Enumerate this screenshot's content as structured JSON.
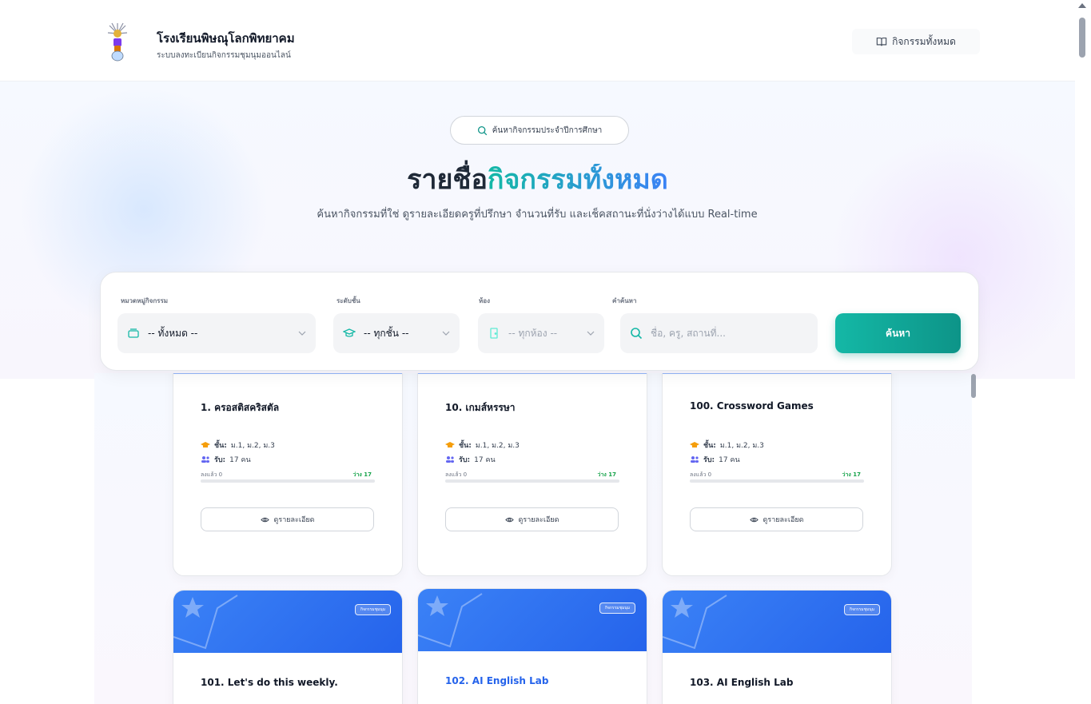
{
  "header": {
    "school_name": "โรงเรียนพิษณุโลกพิทยาคม",
    "subtitle": "ระบบลงทะเบียนกิจกรรมชุมนุมออนไลน์",
    "nav_all_label": "กิจกรรมทั้งหมด"
  },
  "hero": {
    "badge": "ค้นหากิจกรรมประจำปีการศึกษา",
    "title_plain": "รายชื่อ",
    "title_accent": "กิจกรรมทั้งหมด",
    "description": "ค้นหากิจกรรมที่ใช่ ดูรายละเอียดครูที่ปรึกษา จำนวนที่รับ และเช็คสถานะที่นั่งว่างได้แบบ Real-time"
  },
  "filters": {
    "category_label": "หมวดหมู่กิจกรรม",
    "category_value": "-- ทั้งหมด --",
    "grade_label": "ระดับชั้น",
    "grade_value": "-- ทุกชั้น --",
    "room_label": "ห้อง",
    "room_value": "-- ทุกห้อง --",
    "keyword_label": "คำค้นหา",
    "keyword_placeholder": "ชื่อ, ครู, สถานที่...",
    "search_button": "ค้นหา"
  },
  "cards_row1": [
    {
      "title": "1. ครอสติสคริสตัล",
      "grade_label": "ชั้น:",
      "grade_value": "ม.1, ม.2, ม.3",
      "capacity_label": "รับ:",
      "capacity_value": "17 คน",
      "registered": "ลงแล้ว 0",
      "available": "ว่าง 17",
      "detail_button": "ดูรายละเอียด"
    },
    {
      "title": "10. เกมส์หรรษา",
      "grade_label": "ชั้น:",
      "grade_value": "ม.1, ม.2, ม.3",
      "capacity_label": "รับ:",
      "capacity_value": "17 คน",
      "registered": "ลงแล้ว 0",
      "available": "ว่าง 17",
      "detail_button": "ดูรายละเอียด"
    },
    {
      "title": "100. Crossword Games",
      "grade_label": "ชั้น:",
      "grade_value": "ม.1, ม.2, ม.3",
      "capacity_label": "รับ:",
      "capacity_value": "17 คน",
      "registered": "ลงแล้ว 0",
      "available": "ว่าง 17",
      "detail_button": "ดูรายละเอียด"
    }
  ],
  "cards_row2": [
    {
      "title": "101. Let's do this weekly.",
      "tag": "กิจกรรมชุมนุม"
    },
    {
      "title": "102. AI English Lab",
      "tag": "กิจกรรมชุมนุม"
    },
    {
      "title": "103. AI English Lab",
      "tag": "กิจกรรมชุมนุม"
    }
  ],
  "colors": {
    "accent_teal": "#14b8a6",
    "accent_blue": "#3b82f6",
    "banner_blue": "#2563eb",
    "available_green": "#16a34a",
    "highlight_title": "#2563eb"
  }
}
